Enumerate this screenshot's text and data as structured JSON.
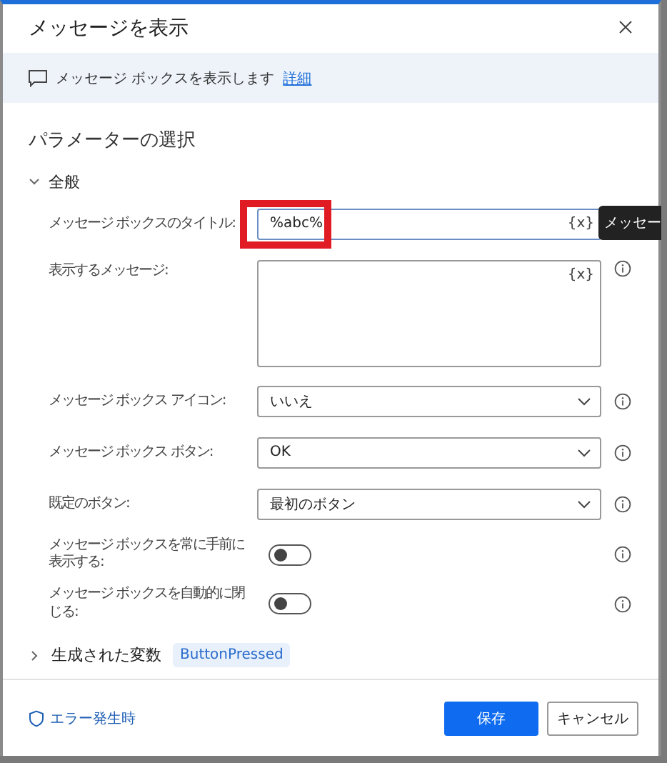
{
  "window": {
    "title": "メッセージを表示"
  },
  "info_bar": {
    "text": "メッセージ ボックスを表示します",
    "link": "詳細"
  },
  "heading": "パラメーターの選択",
  "section": {
    "label": "全般",
    "expanded": true
  },
  "fields": [
    {
      "kind": "text",
      "label": "メッセージ ボックスのタイトル:",
      "value": "%abc%",
      "var_button": "{x}",
      "highlighted": true,
      "has_info": false
    },
    {
      "kind": "textarea",
      "label": "表示するメッセージ:",
      "var_button": "{x}",
      "has_info": true
    },
    {
      "kind": "dropdown",
      "label": "メッセージ ボックス アイコン:",
      "value": "いいえ",
      "has_info": true
    },
    {
      "kind": "dropdown",
      "label": "メッセージ ボックス ボタン:",
      "value": "OK",
      "has_info": true
    },
    {
      "kind": "dropdown",
      "label": "既定のボタン:",
      "value": "最初のボタン",
      "has_info": true
    },
    {
      "kind": "toggle",
      "label": "メッセージ ボックスを常に手前に表示する:",
      "on": false,
      "has_info": true
    },
    {
      "kind": "toggle",
      "label": "メッセージ ボックスを自動的に閉じる:",
      "on": false,
      "has_info": true
    }
  ],
  "tooltip": "メッセー",
  "variables": {
    "label": "生成された変数",
    "expanded": false,
    "tags": [
      "ButtonPressed"
    ]
  },
  "footer": {
    "error_link": "エラー発生時",
    "buttons": [
      {
        "label": "保存",
        "primary": true
      },
      {
        "label": "キャンセル",
        "primary": false
      }
    ]
  }
}
